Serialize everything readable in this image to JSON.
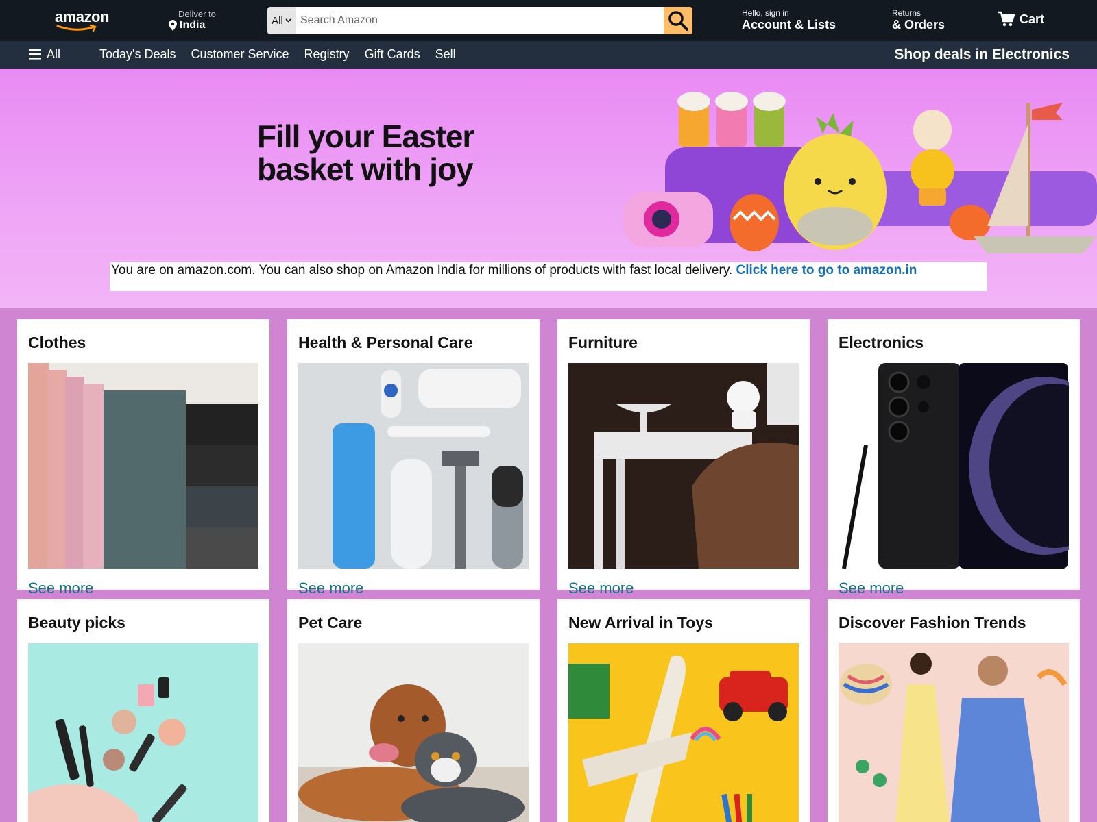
{
  "header": {
    "logo_text": "amazon",
    "deliver_label": "Deliver to",
    "deliver_location": "India",
    "search_category": "All",
    "search_placeholder": "Search Amazon",
    "account_line1": "Hello, sign in",
    "account_line2": "Account & Lists",
    "returns_line1": "Returns",
    "returns_line2": "& Orders",
    "cart_label": "Cart"
  },
  "subnav": {
    "all_label": "All",
    "links": [
      "Today's Deals",
      "Customer Service",
      "Registry",
      "Gift Cards",
      "Sell"
    ],
    "promo": "Shop deals in Electronics"
  },
  "hero": {
    "headline_line1": "Fill your Easter",
    "headline_line2": "basket with joy",
    "notice_text": "You are on amazon.com. You can also shop on Amazon India for millions of products with fast local delivery.",
    "notice_link": "Click here to go to amazon.in"
  },
  "cards": [
    {
      "title": "Clothes",
      "link": "See more"
    },
    {
      "title": "Health & Personal Care",
      "link": "See more"
    },
    {
      "title": "Furniture",
      "link": "See more"
    },
    {
      "title": "Electronics",
      "link": "See more"
    },
    {
      "title": "Beauty picks",
      "link": ""
    },
    {
      "title": "Pet Care",
      "link": ""
    },
    {
      "title": "New Arrival in Toys",
      "link": ""
    },
    {
      "title": "Discover Fashion Trends",
      "link": ""
    }
  ],
  "colors": {
    "header_bg": "#131921",
    "subnav_bg": "#232f3e",
    "search_button": "#febd69",
    "page_bg": "#cf85d2",
    "link": "#117387"
  }
}
